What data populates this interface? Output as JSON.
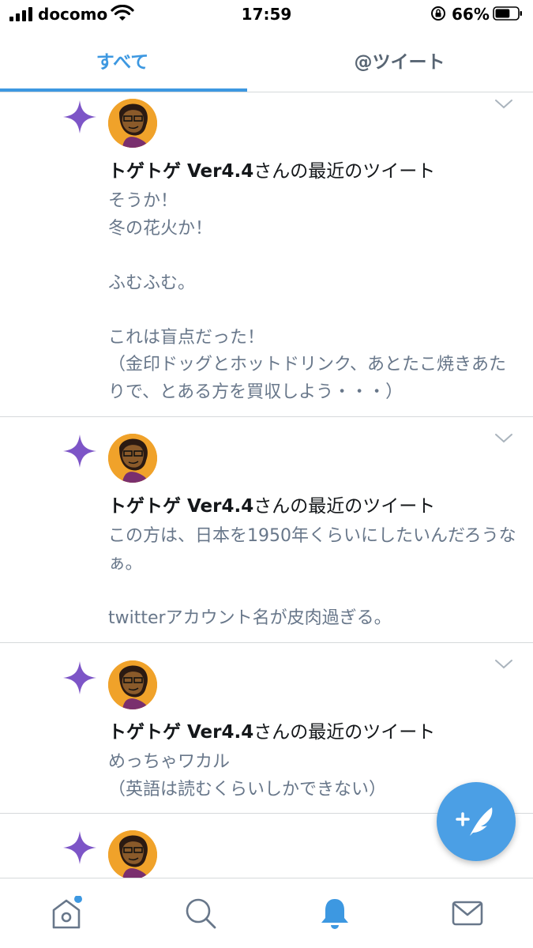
{
  "status_bar": {
    "carrier": "docomo",
    "time": "17:59",
    "battery_percent": "66%",
    "battery_level": 0.66
  },
  "tabs": [
    {
      "label": "すべて",
      "active": true
    },
    {
      "label": "@ツイート",
      "active": false
    }
  ],
  "notifications": [
    {
      "icon": "sparkle-icon",
      "user_name": "トゲトゲ Ver4.4",
      "title_suffix": "さんの最近のツイート",
      "text": "そうか！\n冬の花火か！\n\nふむふむ。\n\nこれは盲点だった！\n（金印ドッグとホットドリンク、あとたこ焼きあたりで、とある方を買収しよう・・・）"
    },
    {
      "icon": "sparkle-icon",
      "user_name": "トゲトゲ Ver4.4",
      "title_suffix": "さんの最近のツイート",
      "text": "この方は、日本を1950年くらいにしたいんだろうなぁ。\n\ntwitterアカウント名が皮肉過ぎる。"
    },
    {
      "icon": "sparkle-icon",
      "user_name": "トゲトゲ Ver4.4",
      "title_suffix": "さんの最近のツイート",
      "text": "めっちゃワカル\n（英語は読むくらいしかできない）"
    },
    {
      "icon": "sparkle-icon",
      "user_name": "",
      "title_suffix": "",
      "text": ""
    }
  ],
  "colors": {
    "accent": "#3d98e1",
    "sparkle": "#7d55c7",
    "avatar_bg": "#f0a22a",
    "body_text": "#68778a",
    "fab": "#4b9fe5"
  },
  "bottom_nav": [
    {
      "icon": "home-icon",
      "has_badge": true
    },
    {
      "icon": "search-icon"
    },
    {
      "icon": "notifications-bell-icon",
      "active": true
    },
    {
      "icon": "messages-envelope-icon"
    }
  ],
  "fab": {
    "icon": "compose-tweet-icon"
  }
}
